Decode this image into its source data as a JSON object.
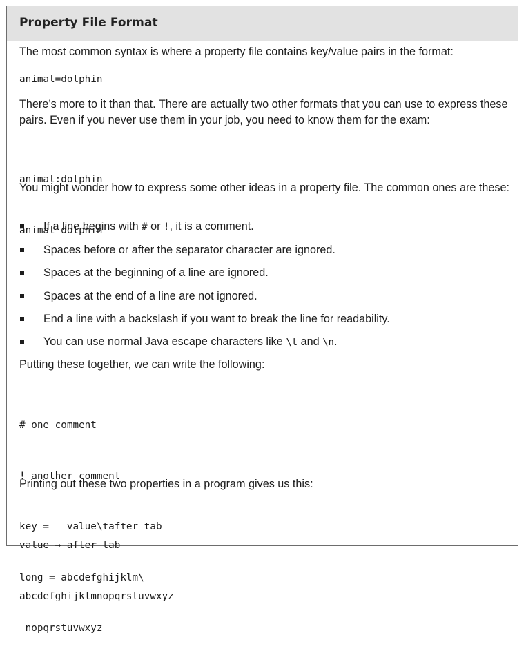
{
  "sidebar_box": {
    "title": "Property File Format",
    "intro": "The most common syntax is where a property file contains key/value pairs in the format:",
    "code_basic": "animal=dolphin",
    "para_formats": "There’s more to it than that. There are actually two other formats that you can use to express these pairs. Even if you never use them in your job, you need to know them for the exam:",
    "code_alt": [
      "animal:dolphin",
      "animal dolphin"
    ],
    "para_ideas": "You might wonder how to express some other ideas in a property file. The common ones are these:",
    "bullets": [
      {
        "before": "If a line begins with ",
        "code1": "#",
        "mid": " or ",
        "code2": "!",
        "after": ", it is a comment."
      },
      {
        "text": "Spaces before or after the separator character are ignored."
      },
      {
        "text": "Spaces at the beginning of a line are ignored."
      },
      {
        "text": "Spaces at the end of a line are not ignored."
      },
      {
        "text": "End a line with a backslash if you want to break the line for readability."
      },
      {
        "before": "You can use normal Java escape characters like ",
        "code1": "\\t",
        "mid": " and ",
        "code2": "\\n",
        "after": "."
      }
    ],
    "para_together": "Putting these together, we can write the following:",
    "code_example": [
      "# one comment",
      "! another comment",
      "key =   value\\tafter tab",
      "long = abcdefghijklm\\",
      " nopqrstuvwxyz"
    ],
    "para_printing": "Printing out these two properties in a program gives us this:",
    "code_output": [
      "value → after tab",
      "abcdefghijklmnopqrstuvwxyz"
    ]
  }
}
